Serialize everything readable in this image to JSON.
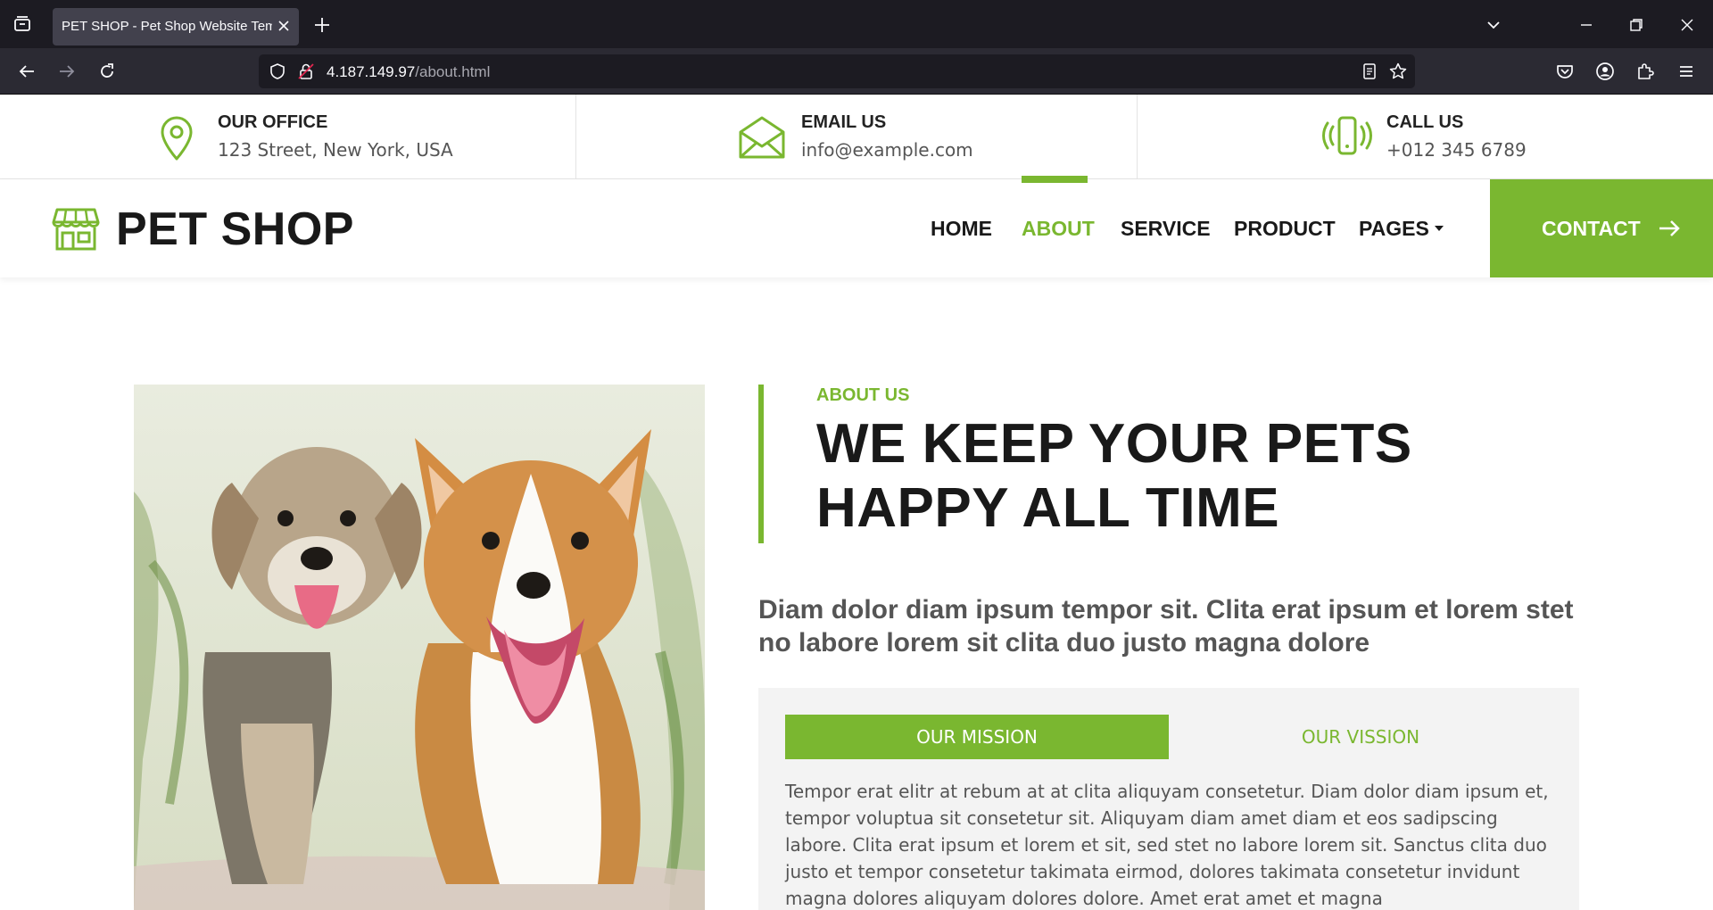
{
  "browser": {
    "tab_title": "PET SHOP - Pet Shop Website Template",
    "url_host": "4.187.149.97",
    "url_path": "/about.html"
  },
  "topbar": {
    "office": {
      "title": "OUR OFFICE",
      "value": "123 Street, New York, USA"
    },
    "email": {
      "title": "EMAIL US",
      "value": "info@example.com"
    },
    "call": {
      "title": "CALL US",
      "value": "+012 345 6789"
    }
  },
  "nav": {
    "brand": "PET SHOP",
    "items": [
      {
        "label": "HOME"
      },
      {
        "label": "ABOUT"
      },
      {
        "label": "SERVICE"
      },
      {
        "label": "PRODUCT"
      },
      {
        "label": "PAGES"
      }
    ],
    "active": "ABOUT",
    "contact_label": "CONTACT"
  },
  "about": {
    "eyebrow": "ABOUT US",
    "heading": "WE KEEP YOUR PETS HAPPY ALL TIME",
    "lead": "Diam dolor diam ipsum tempor sit. Clita erat ipsum et lorem stet no labore lorem sit clita duo justo magna dolore",
    "tabs": [
      {
        "label": "OUR MISSION",
        "active": true
      },
      {
        "label": "OUR VISSION",
        "active": false
      }
    ],
    "mission_text": "Tempor erat elitr at rebum at at clita aliquyam consetetur. Diam dolor diam ipsum et, tempor voluptua sit consetetur sit. Aliquyam diam amet diam et eos sadipscing labore. Clita erat ipsum et lorem et sit, sed stet no labore lorem sit. Sanctus clita duo justo et tempor consetetur takimata eirmod, dolores takimata consetetur invidunt magna dolores aliquyam dolores dolore. Amet erat amet et magna"
  },
  "colors": {
    "accent": "#7ab730",
    "dark_text": "#191919",
    "muted_text": "#555555",
    "panel_bg": "#f3f3f3",
    "browser_tabbar": "#1c1b22",
    "browser_toolbar": "#2b2a33"
  }
}
